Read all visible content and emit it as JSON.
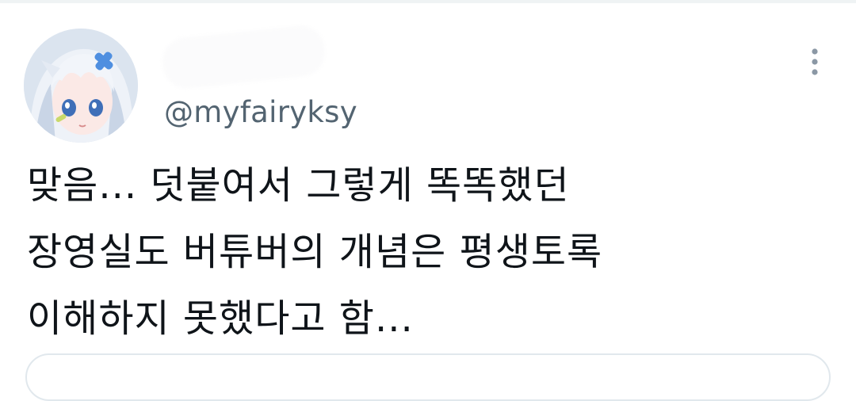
{
  "tweet": {
    "handle": "@myfairyksy",
    "body_lines": [
      "맞음... 덧붙여서 그렇게 똑똑했던",
      "장영실도 버튜버의 개념은 평생토록",
      "이해하지 못했다고 함..."
    ],
    "more_icon": "more-vertical-icon"
  },
  "colors": {
    "text": "#0f1419",
    "secondary": "#536471",
    "divider": "#eff3f4",
    "card_border": "#e1e8ed"
  }
}
